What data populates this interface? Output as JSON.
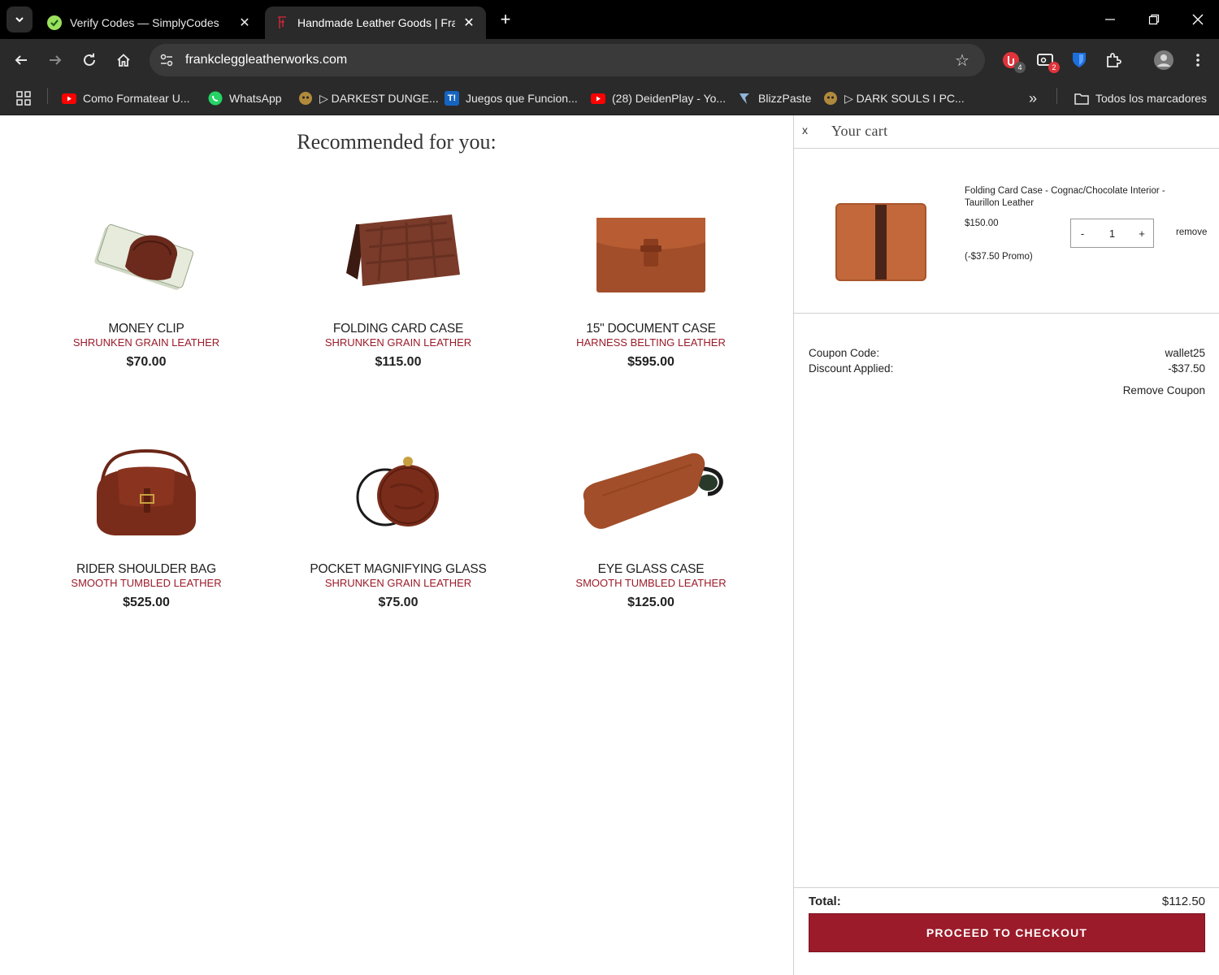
{
  "browser": {
    "tabs": [
      {
        "title": "Verify Codes — SimplyCodes",
        "active": false
      },
      {
        "title": "Handmade Leather Goods | Fra",
        "active": true
      }
    ],
    "url": "frankcleggleatherworks.com",
    "extension_badges": [
      "4",
      "2"
    ],
    "bookmarks": [
      {
        "label": "Como Formatear U..."
      },
      {
        "label": "WhatsApp"
      },
      {
        "label": "▷ DARKEST DUNGE..."
      },
      {
        "label": "Juegos que Funcion..."
      },
      {
        "label": "(28) DeidenPlay - Yo..."
      },
      {
        "label": "BlizzPaste"
      },
      {
        "label": "▷ DARK SOULS I PC..."
      }
    ],
    "bookmarks_overflow": "»",
    "all_bookmarks": "Todos los marcadores",
    "bookmark_badge_t": "T!"
  },
  "recommended": {
    "title": "Recommended for you:",
    "products": [
      {
        "name": "MONEY CLIP",
        "material": "SHRUNKEN GRAIN LEATHER",
        "price": "$70.00"
      },
      {
        "name": "FOLDING CARD CASE",
        "material": "SHRUNKEN GRAIN LEATHER",
        "price": "$115.00"
      },
      {
        "name": "15\" DOCUMENT CASE",
        "material": "HARNESS BELTING LEATHER",
        "price": "$595.00"
      },
      {
        "name": "RIDER SHOULDER BAG",
        "material": "SMOOTH TUMBLED LEATHER",
        "price": "$525.00"
      },
      {
        "name": "POCKET MAGNIFYING GLASS",
        "material": "SHRUNKEN GRAIN LEATHER",
        "price": "$75.00"
      },
      {
        "name": "EYE GLASS CASE",
        "material": "SMOOTH TUMBLED LEATHER",
        "price": "$125.00"
      }
    ]
  },
  "cart": {
    "close": "x",
    "title": "Your cart",
    "item": {
      "name": "Folding Card Case - Cognac/Chocolate Interior - Taurillon Leather",
      "price": "$150.00",
      "promo": "(-$37.50 Promo)",
      "qty_minus": "-",
      "qty": "1",
      "qty_plus": "+",
      "remove": "remove"
    },
    "coupon_label": "Coupon Code:",
    "coupon_value": "wallet25",
    "discount_label": "Discount Applied:",
    "discount_value": "-$37.50",
    "remove_coupon": "Remove Coupon",
    "total_label": "Total:",
    "total_value": "$112.50",
    "checkout": "PROCEED TO CHECKOUT"
  },
  "colors": {
    "brand": "#9b1b2a",
    "chrome_bg": "#2a2a2a",
    "tabbar_bg": "#000000"
  }
}
